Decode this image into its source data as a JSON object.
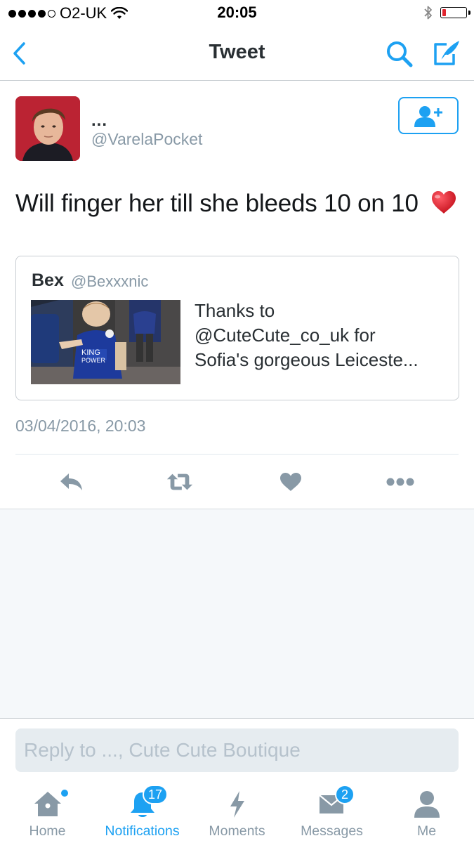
{
  "status_bar": {
    "carrier": "O2-UK",
    "time": "20:05",
    "signal_bars": 4,
    "battery_level": 0.12
  },
  "nav": {
    "title": "Tweet",
    "back_icon": "chevron-left-icon",
    "search_icon": "search-icon",
    "compose_icon": "compose-icon"
  },
  "tweet": {
    "author_name": "...",
    "author_handle": "@VarelaPocket",
    "text": "Will finger her till she bleeds 10 on 10",
    "emoji": "red-heart",
    "timestamp": "03/04/2016, 20:03",
    "quoted": {
      "name": "Bex",
      "handle": "@Bexxxnic",
      "text_lines": [
        "Thanks to",
        "@CuteCute_co_uk for",
        "Sofia's gorgeous Leiceste..."
      ]
    }
  },
  "actions": {
    "reply_icon": "reply-icon",
    "retweet_icon": "retweet-icon",
    "like_icon": "heart-icon",
    "more_icon": "more-icon"
  },
  "reply": {
    "placeholder": "Reply to ..., Cute Cute Boutique"
  },
  "tabs": [
    {
      "label": "Home",
      "icon": "home-icon"
    },
    {
      "label": "Notifications",
      "icon": "bell-icon",
      "badge": "17"
    },
    {
      "label": "Moments",
      "icon": "lightning-icon"
    },
    {
      "label": "Messages",
      "icon": "envelope-icon",
      "badge": "2"
    },
    {
      "label": "Me",
      "icon": "person-icon"
    }
  ],
  "colors": {
    "accent": "#1da1f2",
    "muted": "#8899a6",
    "background_feed": "#f5f8fa"
  }
}
